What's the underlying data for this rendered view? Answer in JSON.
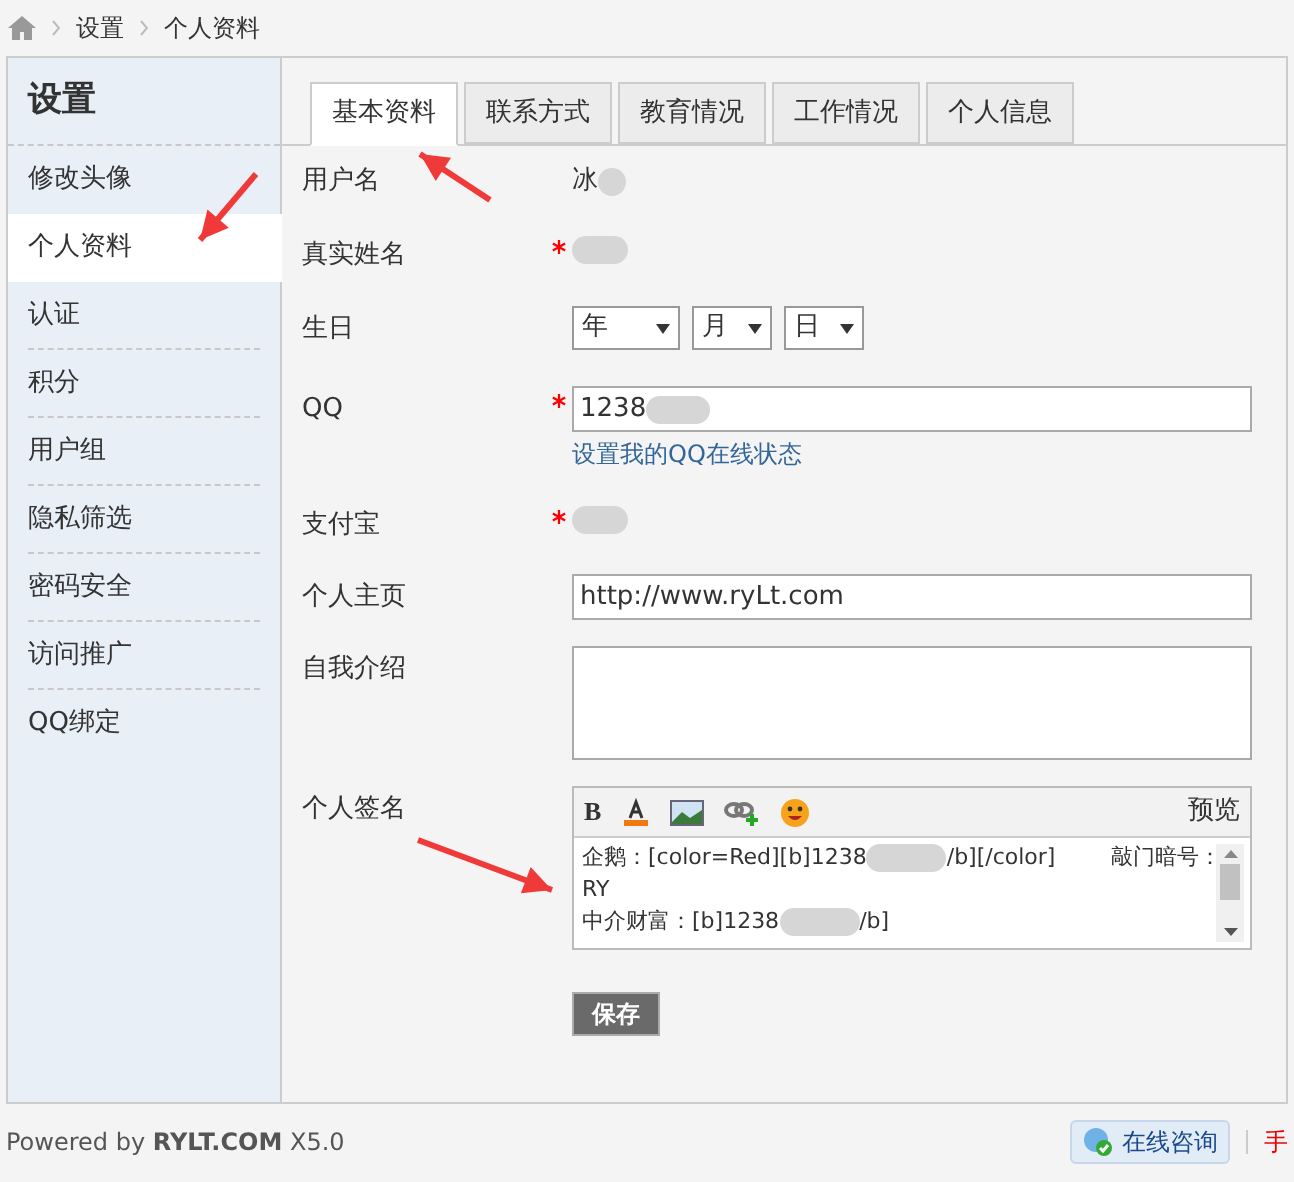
{
  "breadcrumb": [
    "设置",
    "个人资料"
  ],
  "sidebar": {
    "title": "设置",
    "items": [
      {
        "label": "修改头像",
        "selected": false
      },
      {
        "label": "个人资料",
        "selected": true
      },
      {
        "label": "认证",
        "selected": false
      },
      {
        "label": "积分",
        "selected": false
      },
      {
        "label": "用户组",
        "selected": false
      },
      {
        "label": "隐私筛选",
        "selected": false
      },
      {
        "label": "密码安全",
        "selected": false
      },
      {
        "label": "访问推广",
        "selected": false
      },
      {
        "label": "QQ绑定",
        "selected": false
      }
    ]
  },
  "tabs": [
    {
      "label": "基本资料",
      "selected": true
    },
    {
      "label": "联系方式",
      "selected": false
    },
    {
      "label": "教育情况",
      "selected": false
    },
    {
      "label": "工作情况",
      "selected": false
    },
    {
      "label": "个人信息",
      "selected": false
    }
  ],
  "fields": [
    {
      "kind": "static",
      "label": "用户名",
      "required": false,
      "value": "冰"
    },
    {
      "kind": "static",
      "label": "真实姓名",
      "required": true
    },
    {
      "kind": "date",
      "label": "生日",
      "required": false,
      "selects": [
        "年",
        "月",
        "日"
      ]
    },
    {
      "kind": "input",
      "label": "QQ",
      "required": true,
      "value": "1238",
      "link": "设置我的QQ在线状态"
    },
    {
      "kind": "static",
      "label": "支付宝",
      "required": true
    },
    {
      "kind": "input",
      "label": "个人主页",
      "required": false,
      "value": "http://www.ryLt.com"
    },
    {
      "kind": "textarea",
      "label": "自我介绍",
      "required": false
    },
    {
      "kind": "editor",
      "label": "个人签名",
      "required": false,
      "preview": "预览",
      "bold_label": "B",
      "lines": [
        [
          "企鹅：[color=Red][b]1238",
          "/b][/color]",
          "敲门暗号："
        ],
        [
          "RY"
        ],
        [
          "中介财富：[b]1238",
          "/b]"
        ]
      ]
    }
  ],
  "save_button": "保存",
  "footer": {
    "powered": "Powered by **RYLT.COM** X5.0",
    "consult": "在线咨询",
    "cut_text": "手"
  }
}
